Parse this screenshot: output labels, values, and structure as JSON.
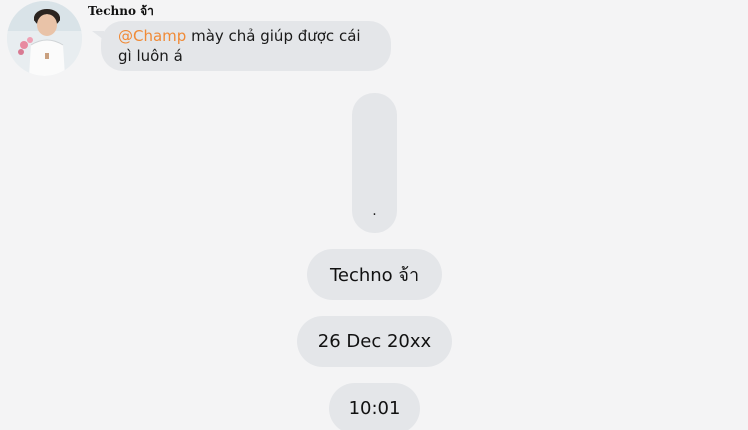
{
  "message": {
    "sender_name": "Techno จ้า",
    "mention": "@Champ",
    "text_line1": " mày chả giúp được cái",
    "text_line2": "gì luôn á"
  },
  "bubble_dot": {
    "text": "."
  },
  "info_pills": {
    "name": "Techno จ้า",
    "date": "26 Dec 20xx",
    "time": "10:01"
  }
}
